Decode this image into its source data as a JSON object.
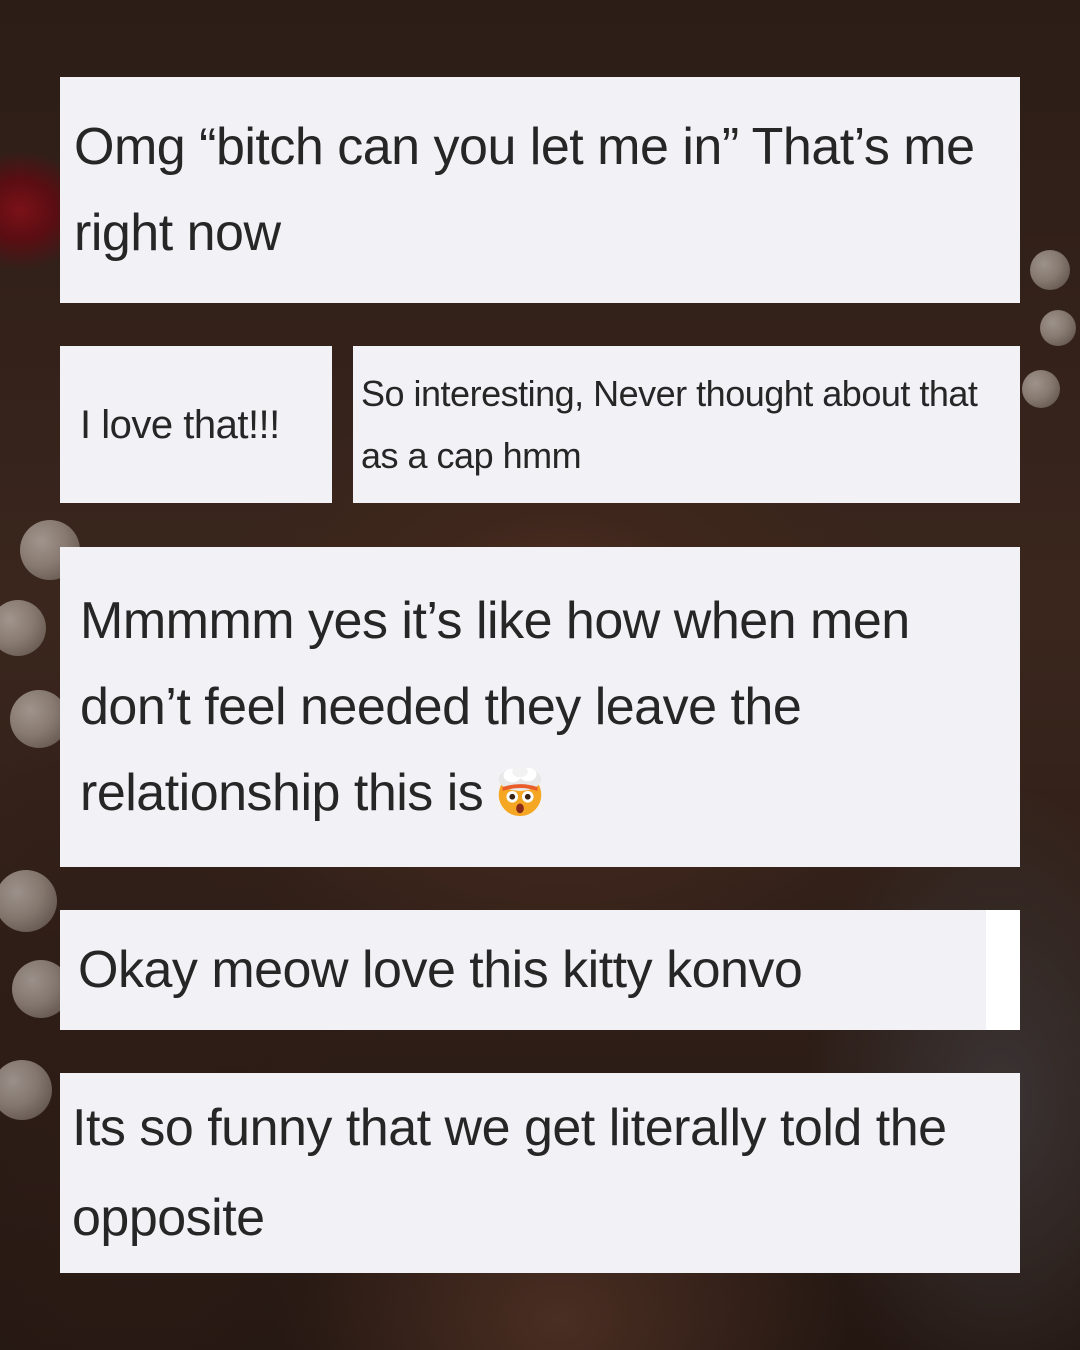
{
  "comments": [
    {
      "id": "c1",
      "text": "Omg “bitch can you let me in” That’s me right now"
    },
    {
      "id": "c2",
      "text": "I love that!!!"
    },
    {
      "id": "c3",
      "text": "So interesting, Never thought about that as a cap hmm"
    },
    {
      "id": "c4",
      "text": "Mmmmm yes it’s like how when men don’t feel needed they leave the relationship this is",
      "emoji": "exploding-head-icon"
    },
    {
      "id": "c5",
      "text": "Okay meow love this kitty konvo"
    },
    {
      "id": "c6",
      "text": "Its so funny that we get literally told the opposite"
    }
  ]
}
